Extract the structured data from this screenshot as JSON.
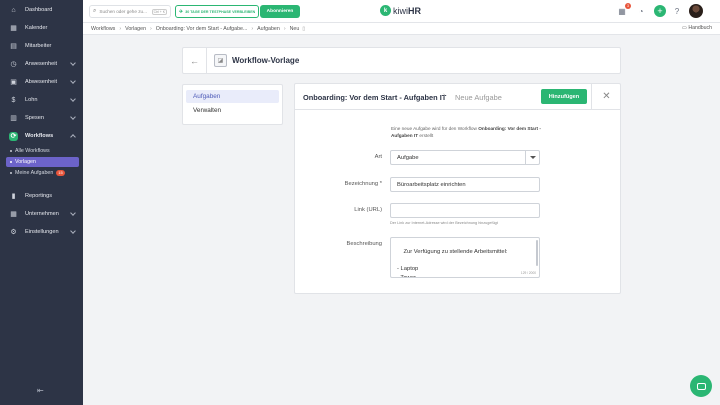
{
  "sidebar": {
    "items": [
      {
        "label": "Dashboard",
        "icon": "home-icon"
      },
      {
        "label": "Kalender",
        "icon": "calendar-icon"
      },
      {
        "label": "Mitarbeiter",
        "icon": "users-icon"
      },
      {
        "label": "Anwesenheit",
        "icon": "clock-icon"
      },
      {
        "label": "Abwesenheit",
        "icon": "suitcase-icon"
      },
      {
        "label": "Lohn",
        "icon": "money-icon"
      },
      {
        "label": "Spesen",
        "icon": "receipt-icon"
      },
      {
        "label": "Workflows",
        "icon": "workflow-icon"
      },
      {
        "label": "Reportings",
        "icon": "chart-icon"
      },
      {
        "label": "Unternehmen",
        "icon": "building-icon"
      },
      {
        "label": "Einstellungen",
        "icon": "gear-icon"
      }
    ],
    "sub_items": [
      {
        "label": "Alle Workflows"
      },
      {
        "label": "Vorlagen"
      },
      {
        "label": "Meine Aufgaben",
        "count": "15"
      }
    ]
  },
  "topbar": {
    "search_placeholder": "Suchen oder gehe zu...",
    "search_shortcut": "Ctrl + K",
    "trial_label": "30 TAGE DER TESTPHASE VERBLEIBEN",
    "subscribe_label": "Abonnieren",
    "logo_kiwi": "kiwi",
    "logo_hr": "HR",
    "notification_count": "3"
  },
  "breadcrumb": {
    "items": [
      "Workflows",
      "Vorlagen",
      "Onboarding: Vor dem Start - Aufgabe...",
      "Aufgaben",
      "Neu"
    ],
    "help_label": "Handbuch"
  },
  "header": {
    "title": "Workflow-Vorlage"
  },
  "side_menu": {
    "items": [
      "Aufgaben",
      "Verwalten"
    ]
  },
  "card": {
    "title": "Onboarding: Vor dem Start - Aufgaben IT",
    "subtitle": "Neue Aufgabe",
    "add_label": "Hinzufügen",
    "intro_pre": "Eine neue Aufgabe wird für den Workflow ",
    "intro_bold": "Onboarding: Vor dem Start - Aufgaben IT",
    "intro_post": " erstellt",
    "fields": {
      "art_label": "Art",
      "art_value": "Aufgabe",
      "bezeichnung_label": "Bezeichnung *",
      "bezeichnung_value": "Büroarbeitsplatz einrichten",
      "link_label": "Link (URL)",
      "link_value": "",
      "link_hint": "Der Link zur Internet-Adresse wird der Bezeichnung hinzugefügt",
      "beschreibung_label": "Beschreibung",
      "beschreibung_value": "Zur Verfügung zu stellende Arbeitsmittel:\n\n- Laptop\n- Tower\n- Bildschirm",
      "beschreibung_counter": "129 / 2000"
    }
  }
}
